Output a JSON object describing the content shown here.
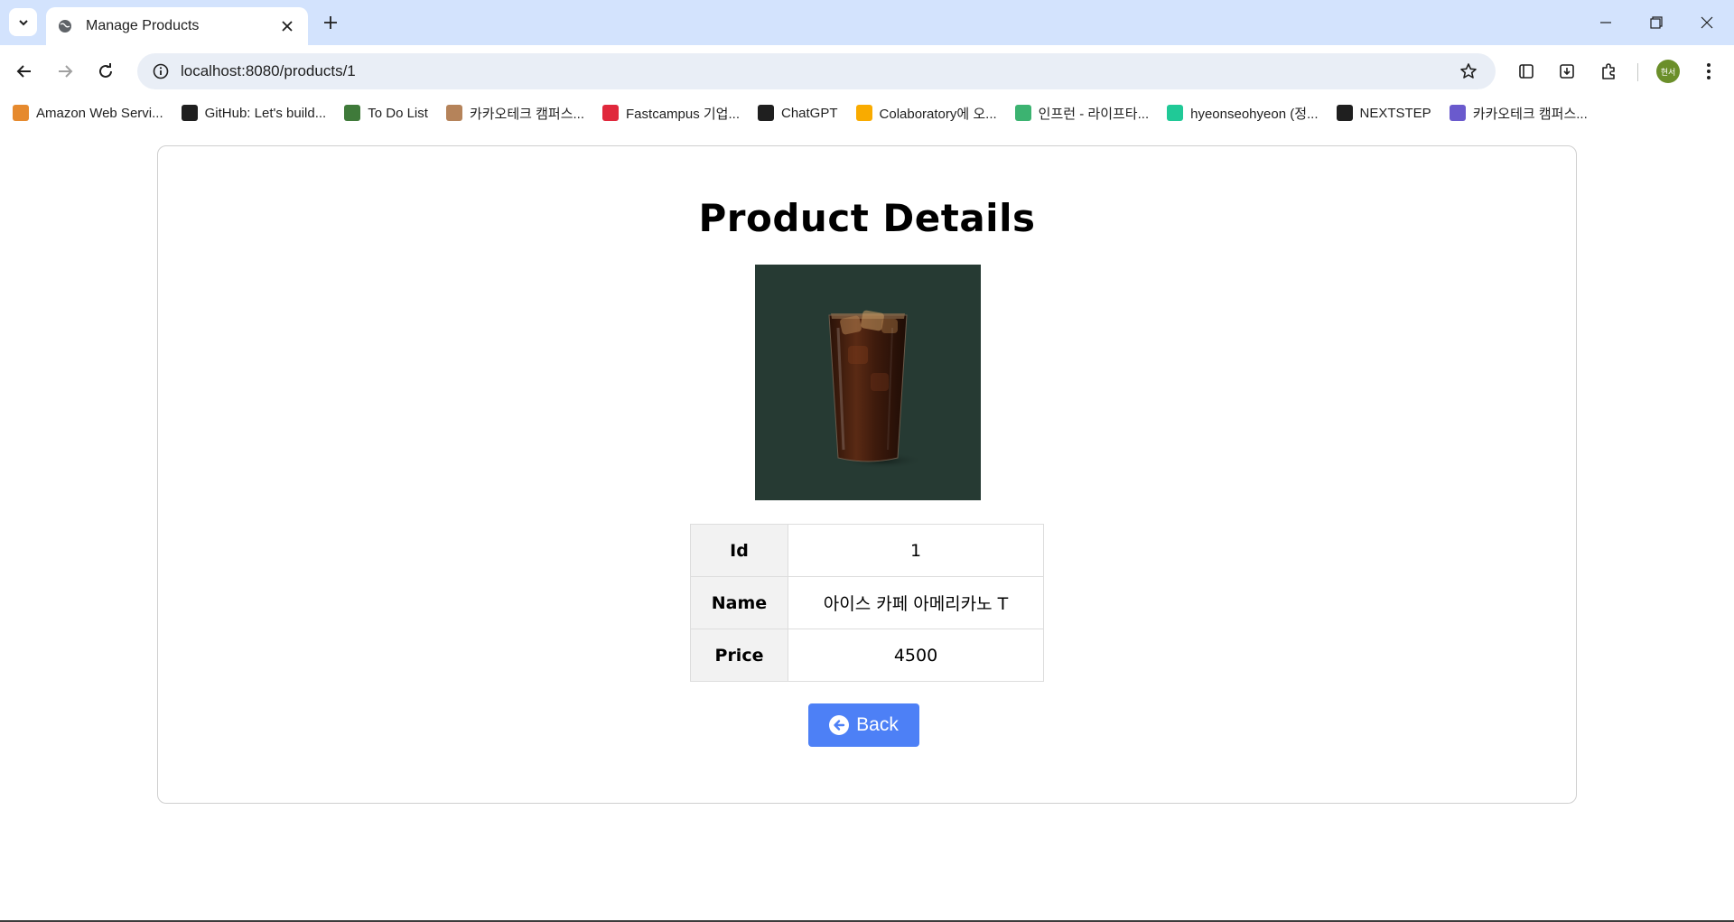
{
  "browser": {
    "tab_title": "Manage Products",
    "url": "localhost:8080/products/1",
    "avatar_text": "현서",
    "bookmarks": [
      {
        "label": "Amazon Web Servi...",
        "icon": "aws-icon",
        "color": "#e68a2e"
      },
      {
        "label": "GitHub: Let's build...",
        "icon": "github-icon",
        "color": "#1f1f1f"
      },
      {
        "label": "To Do List",
        "icon": "leaf-icon",
        "color": "#3f7a3a"
      },
      {
        "label": "카카오테크 캠퍼스...",
        "icon": "cookie-icon",
        "color": "#b5835a"
      },
      {
        "label": "Fastcampus 기업...",
        "icon": "fastcampus-icon",
        "color": "#e0283c"
      },
      {
        "label": "ChatGPT",
        "icon": "chatgpt-icon",
        "color": "#1f1f1f"
      },
      {
        "label": "Colaboratory에 오...",
        "icon": "colab-icon",
        "color": "#f9ab00"
      },
      {
        "label": "인프런 - 라이프타...",
        "icon": "inflearn-icon",
        "color": "#3cb371"
      },
      {
        "label": "hyeonseohyeon (정...",
        "icon": "velog-icon",
        "color": "#20c997"
      },
      {
        "label": "NEXTSTEP",
        "icon": "nextstep-icon",
        "color": "#1f1f1f"
      },
      {
        "label": "카카오테크 캠퍼스...",
        "icon": "kakaotech-icon",
        "color": "#6a5acd"
      }
    ]
  },
  "page": {
    "title": "Product Details",
    "image_alt": "Iced Caffe Americano",
    "fields": [
      {
        "label": "Id",
        "value": "1"
      },
      {
        "label": "Name",
        "value": "아이스 카페 아메리카노 T"
      },
      {
        "label": "Price",
        "value": "4500"
      }
    ],
    "back_label": "Back",
    "accent_color": "#4d80f6"
  }
}
